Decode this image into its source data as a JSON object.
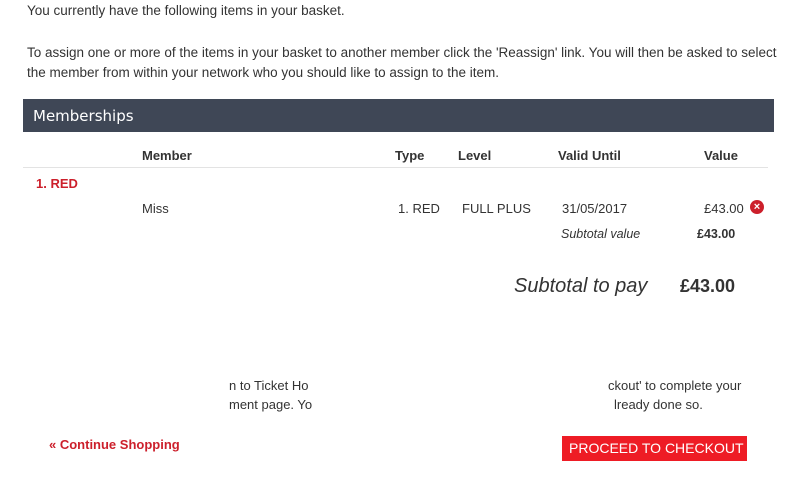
{
  "intro": {
    "line1": "You currently have the following items in your basket.",
    "line2": "To assign one or more of the items in your basket to another member click the 'Reassign' link. You will then be asked to select the member from within your network who you should like to assign to the item."
  },
  "section": {
    "title": "Memberships"
  },
  "table": {
    "headers": {
      "member": "Member",
      "type": "Type",
      "level": "Level",
      "valid_until": "Valid Until",
      "value": "Value"
    },
    "group": "1. RED",
    "row": {
      "member": "Miss",
      "type": "1. RED",
      "level": "FULL PLUS",
      "valid_until": "31/05/2017",
      "value": "£43.00",
      "remove_icon": "remove-icon"
    },
    "subtotal_label": "Subtotal value",
    "subtotal_value": "£43.00"
  },
  "total": {
    "label": "Subtotal to pay",
    "value": "£43.00"
  },
  "notice_fragments": {
    "left_1": "n to Ticket Ho",
    "left_2": "ment page. Yo",
    "right_1": "ckout' to complete your",
    "right_2": "lready done so."
  },
  "actions": {
    "continue": "« Continue Shopping",
    "checkout": "PROCEED TO CHECKOUT"
  },
  "colors": {
    "header_bar": "#3f4756",
    "accent_red": "#cc1f2b",
    "checkout_button": "#ee1c25"
  }
}
